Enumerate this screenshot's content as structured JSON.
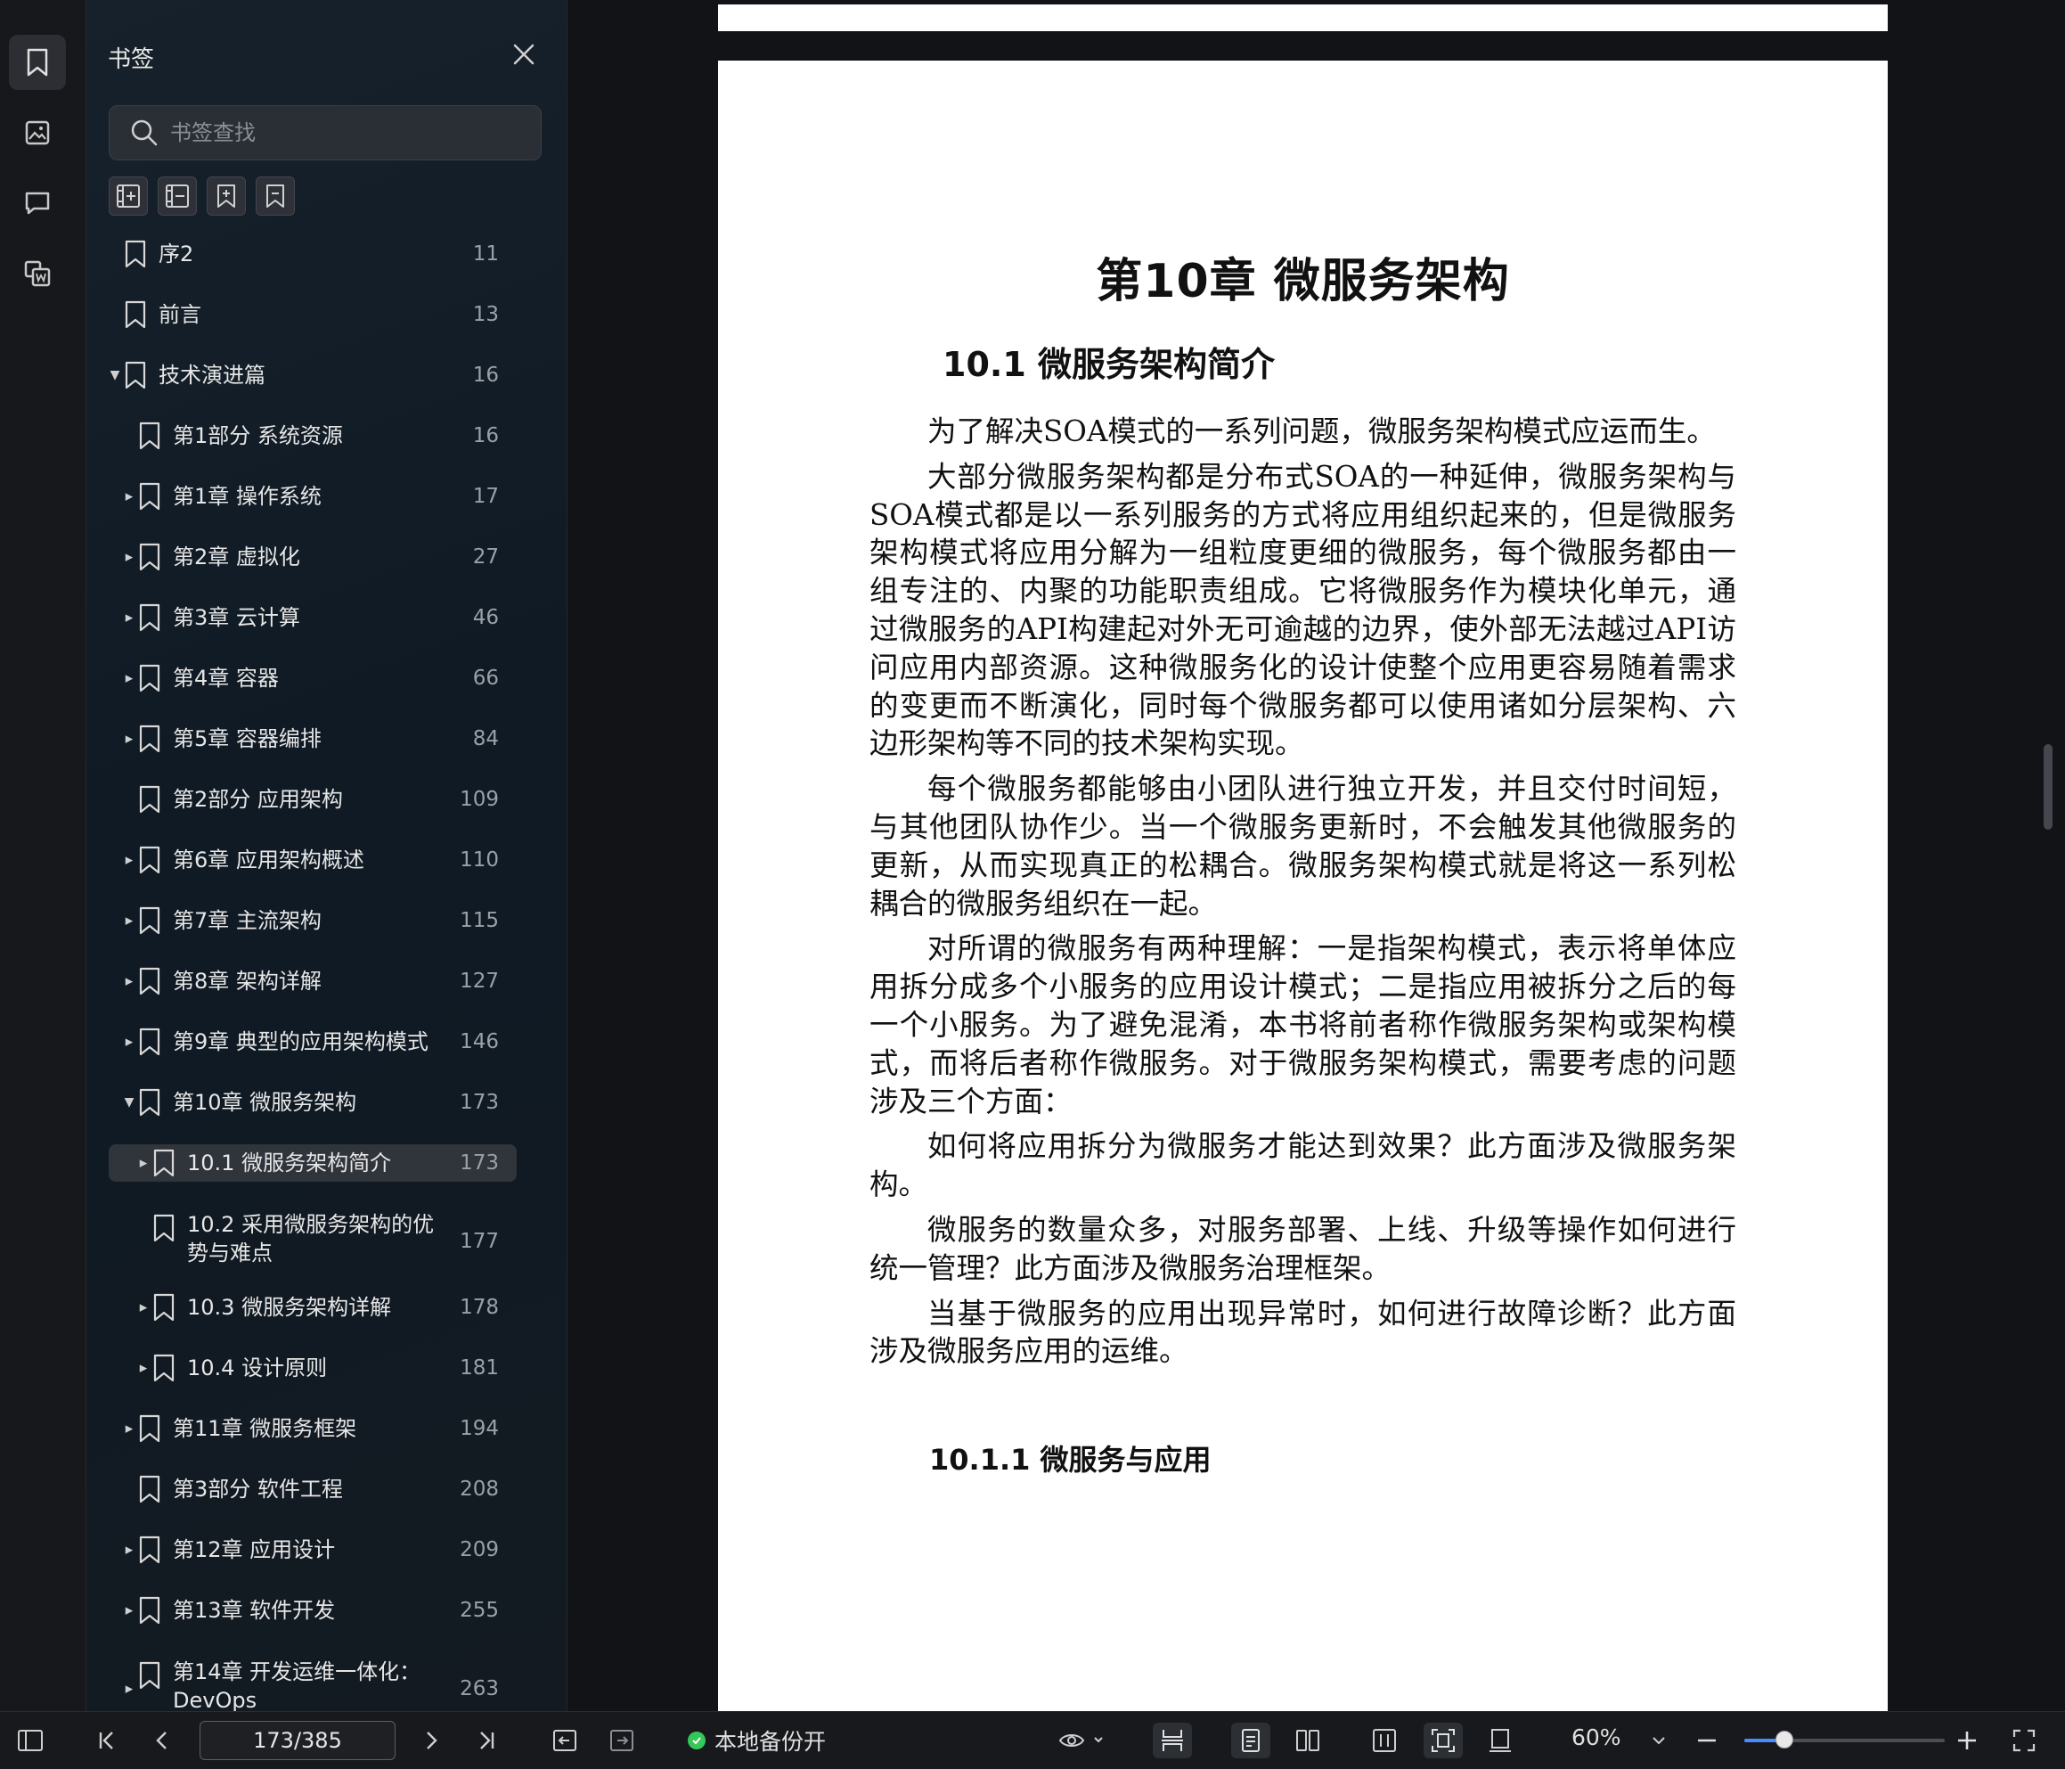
{
  "sidebar": {
    "title": "书签",
    "search_placeholder": "书签查找",
    "items": [
      {
        "label": "序2",
        "page": "11",
        "level": 0,
        "caret": "",
        "selected": false
      },
      {
        "label": "前言",
        "page": "13",
        "level": 0,
        "caret": "",
        "selected": false
      },
      {
        "label": "技术演进篇",
        "page": "16",
        "level": 0,
        "caret": "down",
        "selected": false
      },
      {
        "label": "第1部分 系统资源",
        "page": "16",
        "level": 1,
        "caret": "",
        "selected": false
      },
      {
        "label": "第1章 操作系统",
        "page": "17",
        "level": 1,
        "caret": "right",
        "selected": false
      },
      {
        "label": "第2章 虚拟化",
        "page": "27",
        "level": 1,
        "caret": "right",
        "selected": false
      },
      {
        "label": "第3章 云计算",
        "page": "46",
        "level": 1,
        "caret": "right",
        "selected": false
      },
      {
        "label": "第4章 容器",
        "page": "66",
        "level": 1,
        "caret": "right",
        "selected": false
      },
      {
        "label": "第5章 容器编排",
        "page": "84",
        "level": 1,
        "caret": "right",
        "selected": false
      },
      {
        "label": "第2部分 应用架构",
        "page": "109",
        "level": 1,
        "caret": "",
        "selected": false
      },
      {
        "label": "第6章 应用架构概述",
        "page": "110",
        "level": 1,
        "caret": "right",
        "selected": false
      },
      {
        "label": "第7章 主流架构",
        "page": "115",
        "level": 1,
        "caret": "right",
        "selected": false
      },
      {
        "label": "第8章 架构详解",
        "page": "127",
        "level": 1,
        "caret": "right",
        "selected": false
      },
      {
        "label": "第9章 典型的应用架构模式",
        "page": "146",
        "level": 1,
        "caret": "right",
        "selected": false
      },
      {
        "label": "第10章 微服务架构",
        "page": "173",
        "level": 1,
        "caret": "down",
        "selected": false
      },
      {
        "label": "10.1 微服务架构简介",
        "page": "173",
        "level": 2,
        "caret": "right",
        "selected": true
      },
      {
        "label": "10.2 采用微服务架构的优势与难点",
        "page": "177",
        "level": 2,
        "caret": "",
        "selected": false,
        "wrap": true
      },
      {
        "label": "10.3 微服务架构详解",
        "page": "178",
        "level": 2,
        "caret": "right",
        "selected": false
      },
      {
        "label": "10.4 设计原则",
        "page": "181",
        "level": 2,
        "caret": "right",
        "selected": false
      },
      {
        "label": "第11章 微服务框架",
        "page": "194",
        "level": 1,
        "caret": "right",
        "selected": false
      },
      {
        "label": "第3部分 软件工程",
        "page": "208",
        "level": 1,
        "caret": "",
        "selected": false
      },
      {
        "label": "第12章 应用设计",
        "page": "209",
        "level": 1,
        "caret": "right",
        "selected": false
      },
      {
        "label": "第13章 软件开发",
        "page": "255",
        "level": 1,
        "caret": "right",
        "selected": false
      },
      {
        "label": "第14章 开发运维一体化：DevOps",
        "page": "263",
        "level": 1,
        "caret": "right",
        "selected": false,
        "wrap": true
      }
    ]
  },
  "document": {
    "chapter_title": "第10章 微服务架构",
    "section_title": "10.1 微服务架构简介",
    "paragraphs": [
      "为了解决SOA模式的一系列问题，微服务架构模式应运而生。",
      "大部分微服务架构都是分布式SOA的一种延伸，微服务架构与SOA模式都是以一系列服务的方式将应用组织起来的，但是微服务架构模式将应用分解为一组粒度更细的微服务，每个微服务都由一组专注的、内聚的功能职责组成。它将微服务作为模块化单元，通过微服务的API构建起对外无可逾越的边界，使外部无法越过API访问应用内部资源。这种微服务化的设计使整个应用更容易随着需求的变更而不断演化，同时每个微服务都可以使用诸如分层架构、六边形架构等不同的技术架构实现。",
      "每个微服务都能够由小团队进行独立开发，并且交付时间短，与其他团队协作少。当一个微服务更新时，不会触发其他微服务的更新，从而实现真正的松耦合。微服务架构模式就是将这一系列松耦合的微服务组织在一起。",
      "对所谓的微服务有两种理解：一是指架构模式，表示将单体应用拆分成多个小服务的应用设计模式；二是指应用被拆分之后的每一个小服务。为了避免混淆，本书将前者称作微服务架构或架构模式，而将后者称作微服务。对于微服务架构模式，需要考虑的问题涉及三个方面：",
      "如何将应用拆分为微服务才能达到效果？此方面涉及微服务架构。",
      "微服务的数量众多，对服务部署、上线、升级等操作如何进行统一管理？此方面涉及微服务治理框架。",
      "当基于微服务的应用出现异常时，如何进行故障诊断？此方面涉及微服务应用的运维。"
    ],
    "subsection_title": "10.1.1 微服务与应用"
  },
  "statusbar": {
    "page_indicator": "173/385",
    "backup_label": "本地备份开",
    "zoom": "60%",
    "zoom_fraction": 0.2
  },
  "colors": {
    "accent": "#4a8cff",
    "backup_dot": "#34c759"
  }
}
